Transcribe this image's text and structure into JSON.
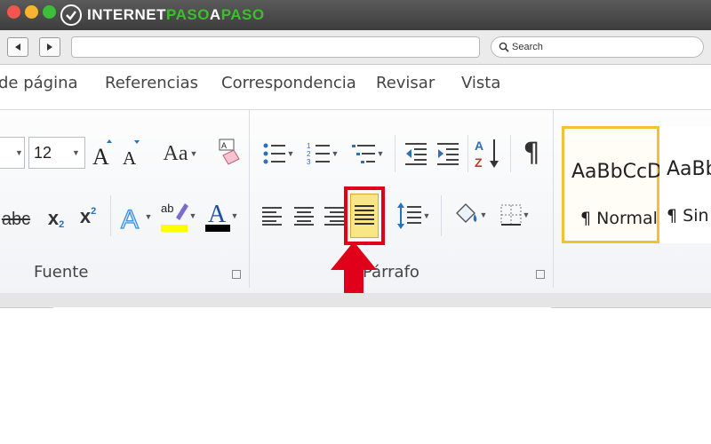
{
  "browser": {
    "logo": {
      "part1": "INTERNET",
      "part2": "PASO",
      "part3": "A",
      "part4": "PASO"
    },
    "search_placeholder": "Search",
    "back_icon": "triangle-left",
    "forward_icon": "triangle-right"
  },
  "ribbon_tabs": [
    "de página",
    "Referencias",
    "Correspondencia",
    "Revisar",
    "Vista"
  ],
  "font_group": {
    "label": "Fuente",
    "font_size": "12",
    "case_button": "Aa",
    "strikethrough": "abc",
    "subscript": "x",
    "subscript_mark": "2",
    "superscript": "x",
    "superscript_mark": "2",
    "highlight_text": "ab",
    "font_color_letter": "A",
    "text_effects_letter": "A"
  },
  "paragraph_group": {
    "label": "Párrafo",
    "pilcrow": "¶"
  },
  "styles_group": {
    "styles": [
      {
        "sample": "AaBbCcDc",
        "name": "¶ Normal",
        "selected": true
      },
      {
        "sample": "AaBbC",
        "name": "¶ Sin e",
        "selected": false
      }
    ]
  },
  "colors": {
    "accent_red": "#e1001a",
    "logo_green": "#3dbe2d",
    "selected_style_border": "#f1c232"
  }
}
